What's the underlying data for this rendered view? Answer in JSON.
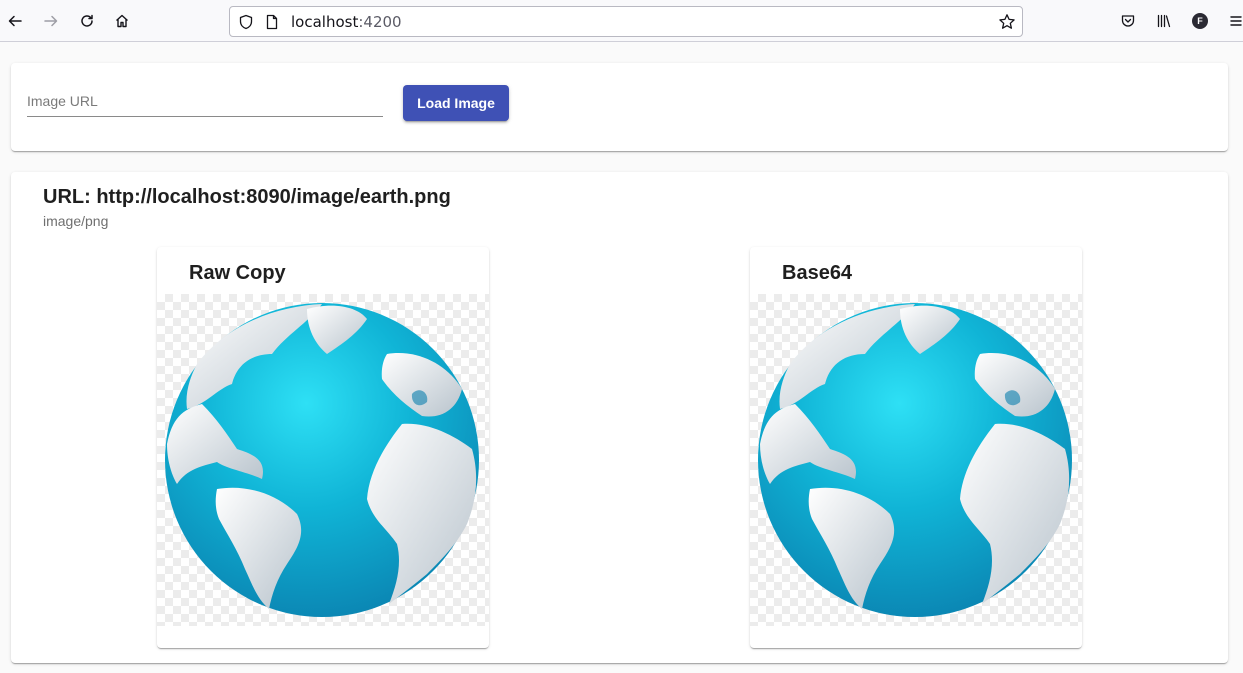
{
  "browser": {
    "url_host": "localhost",
    "url_port": ":4200",
    "avatar_letter": "F"
  },
  "form": {
    "url_placeholder": "Image URL",
    "url_value": "",
    "load_label": "Load Image",
    "load_color": "#3f51b5"
  },
  "result": {
    "url_title": "URL: http://localhost:8090/image/earth.png",
    "mime": "image/png",
    "cards": [
      {
        "title": "Raw Copy",
        "image": "earth-globe-icon"
      },
      {
        "title": "Base64",
        "image": "earth-globe-icon"
      }
    ]
  }
}
